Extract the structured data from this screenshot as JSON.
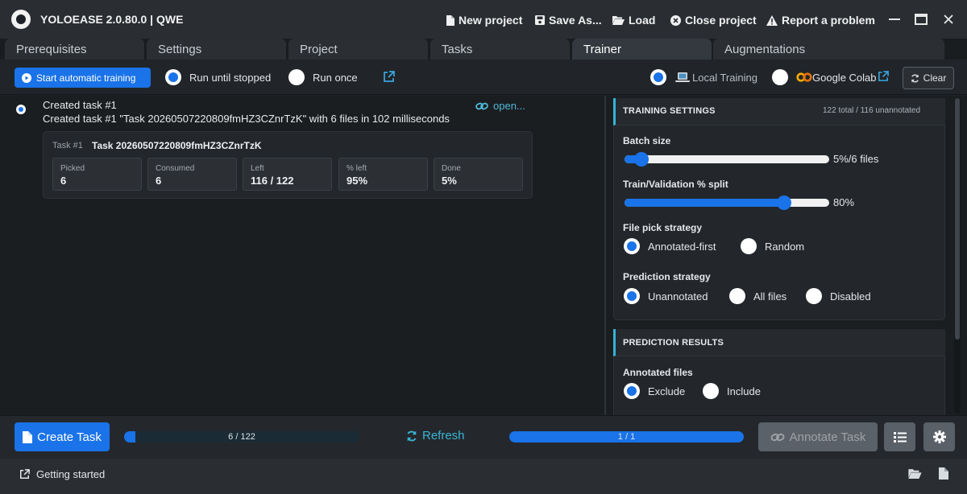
{
  "titlebar": {
    "app_title": "YOLOEASE 2.0.80.0 | QWE",
    "new_project": "New project",
    "save_as": "Save As...",
    "load": "Load",
    "close_project": "Close project",
    "report_problem": "Report a problem"
  },
  "tabs": [
    {
      "label": "Prerequisites"
    },
    {
      "label": "Settings"
    },
    {
      "label": "Project"
    },
    {
      "label": "Tasks"
    },
    {
      "label": "Trainer"
    },
    {
      "label": "Augmentations"
    }
  ],
  "toolbar": {
    "start_training": "Start automatic training",
    "run_until_stopped": "Run until stopped",
    "run_once": "Run once",
    "local_training": "Local Training",
    "google_colab": "Google Colab",
    "clear": "Clear"
  },
  "log": {
    "title": "Created task #1",
    "message": "Created task #1 \"Task 20260507220809fmHZ3CZnrTzK\" with 6 files in 102 milliseconds",
    "open_link": "open...",
    "card": {
      "id_label": "Task #1",
      "name": "Task 20260507220809fmHZ3CZnrTzK",
      "stats": [
        {
          "label": "Picked",
          "value": "6"
        },
        {
          "label": "Consumed",
          "value": "6"
        },
        {
          "label": "Left",
          "value": "116 / 122"
        },
        {
          "label": "% left",
          "value": "95%"
        },
        {
          "label": "Done",
          "value": "5%"
        }
      ]
    }
  },
  "training_settings": {
    "title": "TRAINING SETTINGS",
    "summary": "122 total / 116 unannotated",
    "batch_size": {
      "label": "Batch size",
      "value_text": "5%/6 files",
      "fraction": 0.05
    },
    "split": {
      "label": "Train/Validation % split",
      "value_text": "80%",
      "fraction": 0.8
    },
    "pick_strategy": {
      "label": "File pick strategy",
      "options": [
        "Annotated-first",
        "Random"
      ],
      "selected": "Annotated-first"
    },
    "prediction_strategy": {
      "label": "Prediction strategy",
      "options": [
        "Unannotated",
        "All files",
        "Disabled"
      ],
      "selected": "Unannotated"
    }
  },
  "prediction_results": {
    "title": "PREDICTION RESULTS",
    "annotated_files": {
      "label": "Annotated files",
      "options": [
        "Exclude",
        "Include"
      ],
      "selected": "Exclude"
    }
  },
  "bottom": {
    "create_task": "Create Task",
    "progress_left": {
      "text": "6 / 122",
      "fraction": 0.049
    },
    "refresh": "Refresh",
    "progress_right": {
      "text": "1 / 1",
      "fraction": 1.0
    },
    "annotate_task": "Annotate Task"
  },
  "status": {
    "getting_started": "Getting started"
  },
  "colors": {
    "accent": "#1a73e8",
    "teal": "#35b4d6",
    "background": "#1e2226"
  }
}
